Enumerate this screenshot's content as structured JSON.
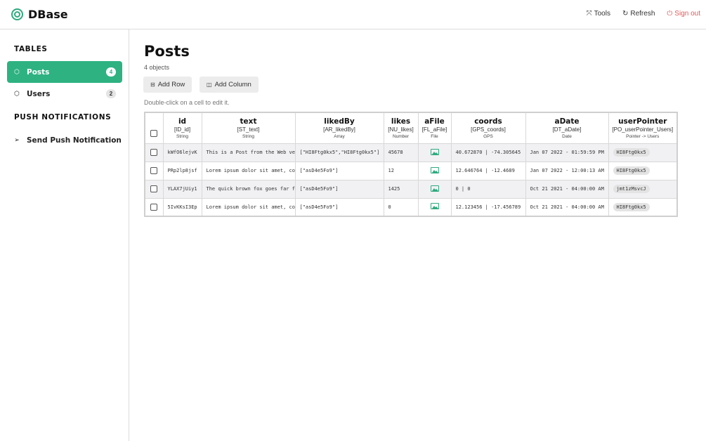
{
  "app": {
    "name": "DBase"
  },
  "header": {
    "actions": [
      {
        "icon": "tools-icon",
        "label": "Tools"
      },
      {
        "icon": "refresh-icon",
        "label": "Refresh"
      },
      {
        "icon": "sign-out-icon",
        "label": "Sign out"
      }
    ]
  },
  "sidebar": {
    "tables_heading": "TABLES",
    "tables": [
      {
        "label": "Posts",
        "count": "4",
        "icon": "cube-icon",
        "active": true
      },
      {
        "label": "Users",
        "count": "2",
        "icon": "cube-icon",
        "active": false
      }
    ],
    "push_heading": "PUSH NOTIFICATIONS",
    "push_items": [
      {
        "label": "Send Push Notification",
        "icon": "send-icon"
      }
    ]
  },
  "main": {
    "title": "Posts",
    "subtitle": "4 objects",
    "add_row_label": "Add Row",
    "add_column_label": "Add Column",
    "hint": "Double-click on a cell to edit it."
  },
  "table": {
    "columns": [
      {
        "name": "id",
        "key": "[ID_id]",
        "type": "String"
      },
      {
        "name": "text",
        "key": "[ST_text]",
        "type": "String"
      },
      {
        "name": "likedBy",
        "key": "[AR_likedBy]",
        "type": "Array"
      },
      {
        "name": "likes",
        "key": "[NU_likes]",
        "type": "Number"
      },
      {
        "name": "aFile",
        "key": "[FL_aFile]",
        "type": "File"
      },
      {
        "name": "coords",
        "key": "[GPS_coords]",
        "type": "GPS"
      },
      {
        "name": "aDate",
        "key": "[DT_aDate]",
        "type": "Date"
      },
      {
        "name": "userPointer",
        "key": "[PO_userPointer_Users]",
        "type": "Pointer -> Users"
      }
    ],
    "rows": [
      {
        "id": "kWfO6lejvK",
        "text": "This is a Post from the Web ve",
        "likedBy": "[\"HI8Ftg0kx5\",\"HI8Ftg0kx5\"]",
        "likes": "45678",
        "coords": "40.672870 | -74.305645",
        "aDate": "Jan 07 2022 - 01:59:59 PM",
        "userPointer": "HI8Ftg0kx5"
      },
      {
        "id": "PRp2lp8jsf",
        "text": "Lorem ipsum dolor sit amet, co",
        "likedBy": "[\"asD4e5Fo9\"]",
        "likes": "12",
        "coords": "12.646764 | -12.4689",
        "aDate": "Jan 07 2022 - 12:00:13 AM",
        "userPointer": "HI8Ftg0kx5"
      },
      {
        "id": "YLAX7jUiy1",
        "text": "The quick brown fox goes far f",
        "likedBy": "[\"asD4e5Fo9\"]",
        "likes": "1425",
        "coords": "0 | 0",
        "aDate": "Oct 21 2021 - 04:00:00 AM",
        "userPointer": "jmt1zMsvcJ"
      },
      {
        "id": "5IvKKsI3Ep",
        "text": "Lorem ipsum dolor sit amet, co",
        "likedBy": "[\"asD4e5Fo9\"]",
        "likes": "0",
        "coords": "12.123456 | -17.456789",
        "aDate": "Oct 21 2021 - 04:00:00 AM",
        "userPointer": "HI8Ftg0kx5"
      }
    ]
  },
  "colors": {
    "accent": "#2eb282",
    "danger": "#e05a5a",
    "row_shade": "#f1f1f4"
  }
}
